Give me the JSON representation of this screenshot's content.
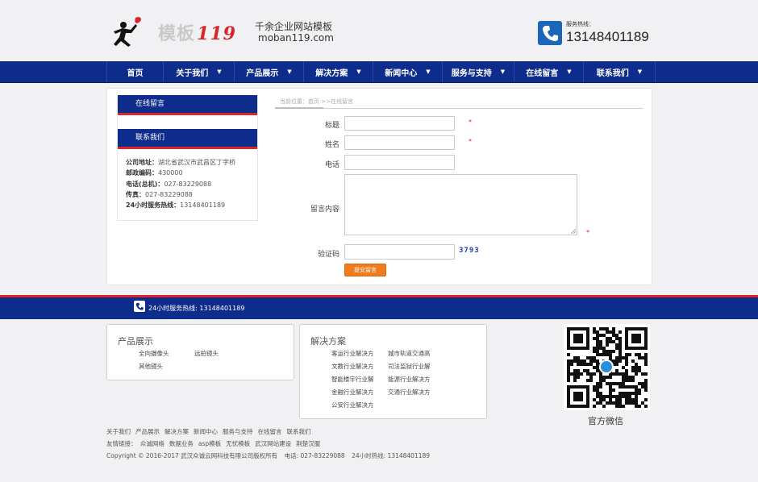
{
  "header": {
    "logo_cn": "模板",
    "logo_num": "119",
    "tagline_1": "千余企业网站模板",
    "tagline_2": "moban119.com",
    "hotline_label": "服务热线：",
    "hotline_number": "13148401189"
  },
  "nav": {
    "items": [
      {
        "label": "首页",
        "caret": ""
      },
      {
        "label": "关于我们",
        "caret": "▼"
      },
      {
        "label": "产品展示",
        "caret": "▼"
      },
      {
        "label": "解决方案",
        "caret": "▼"
      },
      {
        "label": "新闻中心",
        "caret": "▼"
      },
      {
        "label": "服务与支持",
        "caret": "▼"
      },
      {
        "label": "在线留言",
        "caret": "▼"
      },
      {
        "label": "联系我们",
        "caret": "▼"
      }
    ]
  },
  "sidebar": {
    "title_1": "在线留言",
    "title_2": "联系我们",
    "contact": [
      {
        "k": "公司地址：",
        "v": "湖北省武汉市武昌区丁字桥"
      },
      {
        "k": "邮政编码：",
        "v": "430000"
      },
      {
        "k": "电话(总机)：",
        "v": "027-83229088"
      },
      {
        "k": "传真：",
        "v": "027-83229088"
      },
      {
        "k": "24小时服务热线：",
        "v": "13148401189"
      }
    ]
  },
  "breadcrumb": "当前位置：首页 >>在线留言",
  "form": {
    "title_label": "标题",
    "name_label": "姓名",
    "phone_label": "电话",
    "content_label": "留言内容",
    "captcha_label": "验证码",
    "required_mark": "*",
    "captcha_code": "3793",
    "submit_label": "提交留言"
  },
  "band": {
    "text": "24小时服务热线: 13148401189"
  },
  "footer": {
    "products_title": "产品展示",
    "products": [
      "全向摄像头",
      "远拍镜头",
      "其他镜头"
    ],
    "solutions_title": "解决方案",
    "solutions": [
      "客运行业解决方",
      "城市轨道交通高",
      "文教行业解决方",
      "司法监狱行业解",
      "智能楼宇行业解",
      "能源行业解决方",
      "金融行业解决方",
      "交通行业解决方",
      "公安行业解决方"
    ],
    "qr_label": "官方微信",
    "links_row": [
      "关于我们",
      "产品展示",
      "解决方案",
      "新闻中心",
      "服务与支持",
      "在线留言",
      "联系我们"
    ],
    "friend_label": "友情链接：",
    "friend_links": [
      "众诚网络",
      "数据业务",
      "asp模板",
      "无忧模板",
      "武汉网站建设",
      "荆楚汉服"
    ],
    "copyright": "Copyright © 2016-2017 武汉众诚云网科技有限公司版权所有",
    "tel": "电话: 027-83229088",
    "hotline": "24小时热线: 13148401189"
  },
  "colors": {
    "nav_blue": "#0e2c8b",
    "accent_red": "#d8262a",
    "submit_orange": "#f07c1e",
    "phone_icon_blue": "#1b66b9"
  }
}
